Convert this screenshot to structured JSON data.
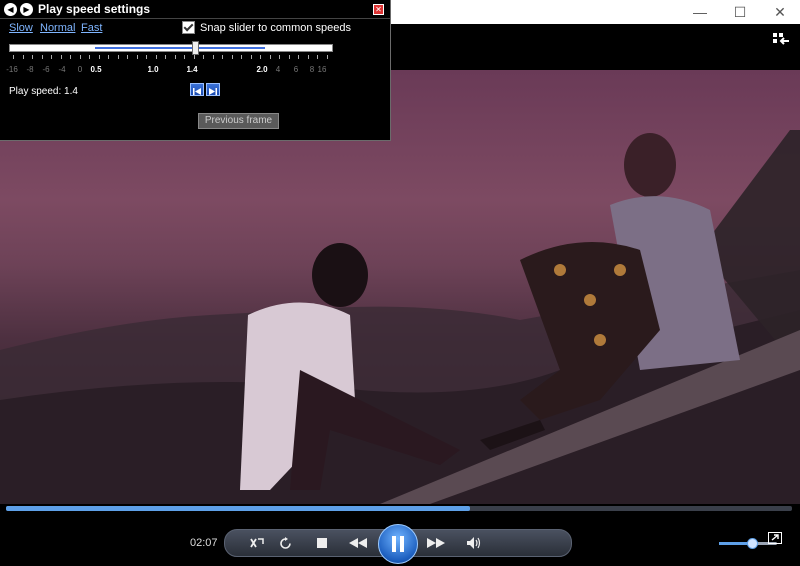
{
  "window": {
    "minimize_label": "—",
    "maximize_label": "☐",
    "close_label": "✕"
  },
  "dialog": {
    "title": "Play speed settings",
    "links": {
      "slow": "Slow",
      "normal": "Normal",
      "fast": "Fast"
    },
    "snap_label": "Snap slider to common speeds",
    "snap_checked": true,
    "tick_labels": [
      "-16",
      "-8",
      "-6",
      "-4",
      "0",
      "0.5",
      "1.0",
      "1.4",
      "2.0",
      "4",
      "6",
      "8",
      "16"
    ],
    "play_speed": "Play speed: 1.4",
    "previous_frame": "Previous frame",
    "close_label": "✕"
  },
  "player": {
    "time": "02:07",
    "seek_progress": 0.59,
    "volume_level": 0.55,
    "accent_color": "#5ea0e8"
  }
}
